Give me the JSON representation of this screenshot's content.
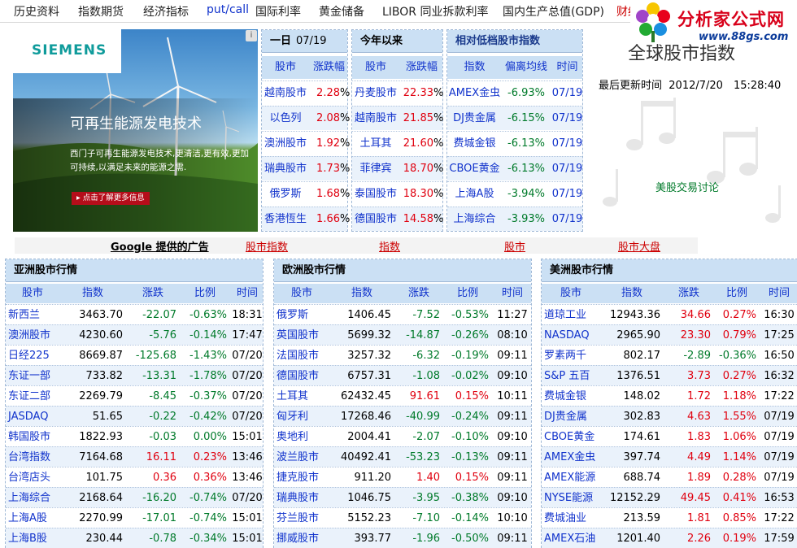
{
  "nav": [
    {
      "label": "历史资料",
      "style": "normal"
    },
    {
      "label": "指数期货",
      "style": "normal"
    },
    {
      "label": "经济指标",
      "style": "normal"
    },
    {
      "label": "put/call",
      "style": "blue"
    },
    {
      "label": "国际利率",
      "style": "normal"
    },
    {
      "label": "黄金储备",
      "style": "normal"
    },
    {
      "label": "LIBOR 同业拆款利率",
      "style": "normal"
    },
    {
      "label": "国内生产总值(GDP)",
      "style": "normal"
    },
    {
      "label": "财经",
      "style": "red"
    }
  ],
  "logo": {
    "brand": "分析家公式网",
    "url": "www.88gs.com"
  },
  "ad": {
    "brand": "SIEMENS",
    "info": "i",
    "headline": "可再生能源发电技术",
    "body": "西门子可再生能源发电技术,更清洁,更有效,更加可持续,以满足未来的能源之需.",
    "cta": "▸ 点击了解更多信息"
  },
  "day_panel": {
    "title": "一日",
    "date": "07/19",
    "headers": [
      "股市",
      "涨跌幅"
    ],
    "rows": [
      {
        "name": "越南股市",
        "val": "2.28",
        "pct": "%"
      },
      {
        "name": "以色列",
        "val": "2.08",
        "pct": "%"
      },
      {
        "name": "澳洲股市",
        "val": "1.92",
        "pct": "%"
      },
      {
        "name": "瑞典股市",
        "val": "1.73",
        "pct": "%"
      },
      {
        "name": "俄罗斯",
        "val": "1.68",
        "pct": "%"
      },
      {
        "name": "香港恆生",
        "val": "1.66",
        "pct": "%"
      }
    ]
  },
  "ytd_panel": {
    "title": "今年以来",
    "headers": [
      "股市",
      "涨跌幅"
    ],
    "rows": [
      {
        "name": "丹麦股市",
        "val": "22.33",
        "pct": "%"
      },
      {
        "name": "越南股市",
        "val": "21.85",
        "pct": "%"
      },
      {
        "name": "土耳其",
        "val": "21.60",
        "pct": "%"
      },
      {
        "name": "菲律宾",
        "val": "18.70",
        "pct": "%"
      },
      {
        "name": "泰国股市",
        "val": "18.30",
        "pct": "%"
      },
      {
        "name": "德国股市",
        "val": "14.58",
        "pct": "%"
      }
    ]
  },
  "low_panel": {
    "title": "相对低档股市指数",
    "headers": [
      "指数",
      "偏离均线",
      "时间"
    ],
    "rows": [
      {
        "name": "AMEX金虫",
        "val": "-6.93%",
        "time": "07/19"
      },
      {
        "name": "DJ贵金属",
        "val": "-6.15%",
        "time": "07/19"
      },
      {
        "name": "费城金银",
        "val": "-6.13%",
        "time": "07/19"
      },
      {
        "name": "CBOE黄金",
        "val": "-6.13%",
        "time": "07/19"
      },
      {
        "name": "上海A股",
        "val": "-3.94%",
        "time": "07/19"
      },
      {
        "name": "上海综合",
        "val": "-3.93%",
        "time": "07/19"
      }
    ]
  },
  "global": {
    "title": "全球股市指数",
    "updated_label": "最后更新时间",
    "updated_value": "2012/7/20　15:28:40",
    "discuss": "美股交易讨论"
  },
  "links": [
    "Google 提供的广告",
    "股市指数",
    "指数",
    "股市",
    "股市大盘"
  ],
  "headers": [
    "股市",
    "指数",
    "涨跌",
    "比例",
    "时间"
  ],
  "asia": {
    "title": "亚洲股市行情",
    "rows": [
      {
        "name": "新西兰",
        "idx": "3463.70",
        "chg": "-22.07",
        "pct": "-0.63%",
        "time": "18:31",
        "c": "green"
      },
      {
        "name": "澳洲股市",
        "idx": "4230.60",
        "chg": "-5.76",
        "pct": "-0.14%",
        "time": "17:47",
        "c": "green"
      },
      {
        "name": "日经225",
        "idx": "8669.87",
        "chg": "-125.68",
        "pct": "-1.43%",
        "time": "07/20",
        "c": "green"
      },
      {
        "name": "东证一部",
        "idx": "733.82",
        "chg": "-13.31",
        "pct": "-1.78%",
        "time": "07/20",
        "c": "green"
      },
      {
        "name": "东证二部",
        "idx": "2269.79",
        "chg": "-8.45",
        "pct": "-0.37%",
        "time": "07/20",
        "c": "green"
      },
      {
        "name": "JASDAQ",
        "idx": "51.65",
        "chg": "-0.22",
        "pct": "-0.42%",
        "time": "07/20",
        "c": "green"
      },
      {
        "name": "韩国股市",
        "idx": "1822.93",
        "chg": "-0.03",
        "pct": "0.00%",
        "time": "15:01",
        "c": "green"
      },
      {
        "name": "台湾指数",
        "idx": "7164.68",
        "chg": "16.11",
        "pct": "0.23%",
        "time": "13:46",
        "c": "red"
      },
      {
        "name": "台湾店头",
        "idx": "101.75",
        "chg": "0.36",
        "pct": "0.36%",
        "time": "13:46",
        "c": "red"
      },
      {
        "name": "上海综合",
        "idx": "2168.64",
        "chg": "-16.20",
        "pct": "-0.74%",
        "time": "07/20",
        "c": "green"
      },
      {
        "name": "上海A股",
        "idx": "2270.99",
        "chg": "-17.01",
        "pct": "-0.74%",
        "time": "15:01",
        "c": "green"
      },
      {
        "name": "上海B股",
        "idx": "230.44",
        "chg": "-0.78",
        "pct": "-0.34%",
        "time": "15:01",
        "c": "green"
      }
    ]
  },
  "europe": {
    "title": "欧洲股市行情",
    "rows": [
      {
        "name": "俄罗斯",
        "idx": "1406.45",
        "chg": "-7.52",
        "pct": "-0.53%",
        "time": "11:27",
        "c": "green"
      },
      {
        "name": "英国股市",
        "idx": "5699.32",
        "chg": "-14.87",
        "pct": "-0.26%",
        "time": "08:10",
        "c": "green"
      },
      {
        "name": "法国股市",
        "idx": "3257.32",
        "chg": "-6.32",
        "pct": "-0.19%",
        "time": "09:11",
        "c": "green"
      },
      {
        "name": "德国股市",
        "idx": "6757.31",
        "chg": "-1.08",
        "pct": "-0.02%",
        "time": "09:10",
        "c": "green"
      },
      {
        "name": "土耳其",
        "idx": "62432.45",
        "chg": "91.61",
        "pct": "0.15%",
        "time": "10:11",
        "c": "red"
      },
      {
        "name": "匈牙利",
        "idx": "17268.46",
        "chg": "-40.99",
        "pct": "-0.24%",
        "time": "09:11",
        "c": "green"
      },
      {
        "name": "奥地利",
        "idx": "2004.41",
        "chg": "-2.07",
        "pct": "-0.10%",
        "time": "09:10",
        "c": "green"
      },
      {
        "name": "波兰股市",
        "idx": "40492.41",
        "chg": "-53.23",
        "pct": "-0.13%",
        "time": "09:11",
        "c": "green"
      },
      {
        "name": "捷克股市",
        "idx": "911.20",
        "chg": "1.40",
        "pct": "0.15%",
        "time": "09:11",
        "c": "red"
      },
      {
        "name": "瑞典股市",
        "idx": "1046.75",
        "chg": "-3.95",
        "pct": "-0.38%",
        "time": "09:10",
        "c": "green"
      },
      {
        "name": "芬兰股市",
        "idx": "5152.23",
        "chg": "-7.10",
        "pct": "-0.14%",
        "time": "10:10",
        "c": "green"
      },
      {
        "name": "挪威股市",
        "idx": "393.77",
        "chg": "-1.96",
        "pct": "-0.50%",
        "time": "09:11",
        "c": "green"
      }
    ]
  },
  "us": {
    "title": "美洲股市行情",
    "rows": [
      {
        "name": "道琼工业",
        "idx": "12943.36",
        "chg": "34.66",
        "pct": "0.27%",
        "time": "16:30",
        "c": "red"
      },
      {
        "name": "NASDAQ",
        "idx": "2965.90",
        "chg": "23.30",
        "pct": "0.79%",
        "time": "17:25",
        "c": "red"
      },
      {
        "name": "罗素两千",
        "idx": "802.17",
        "chg": "-2.89",
        "pct": "-0.36%",
        "time": "16:50",
        "c": "green"
      },
      {
        "name": "S&P 五百",
        "idx": "1376.51",
        "chg": "3.73",
        "pct": "0.27%",
        "time": "16:32",
        "c": "red"
      },
      {
        "name": "费城金银",
        "idx": "148.02",
        "chg": "1.72",
        "pct": "1.18%",
        "time": "17:22",
        "c": "red"
      },
      {
        "name": "DJ贵金属",
        "idx": "302.83",
        "chg": "4.63",
        "pct": "1.55%",
        "time": "07/19",
        "c": "red"
      },
      {
        "name": "CBOE黄金",
        "idx": "174.61",
        "chg": "1.83",
        "pct": "1.06%",
        "time": "07/19",
        "c": "red"
      },
      {
        "name": "AMEX金虫",
        "idx": "397.74",
        "chg": "4.49",
        "pct": "1.14%",
        "time": "07/19",
        "c": "red"
      },
      {
        "name": "AMEX能源",
        "idx": "688.74",
        "chg": "1.89",
        "pct": "0.28%",
        "time": "07/19",
        "c": "red"
      },
      {
        "name": "NYSE能源",
        "idx": "12152.29",
        "chg": "49.45",
        "pct": "0.41%",
        "time": "16:53",
        "c": "red"
      },
      {
        "name": "费城油业",
        "idx": "213.59",
        "chg": "1.81",
        "pct": "0.85%",
        "time": "17:22",
        "c": "red"
      },
      {
        "name": "AMEX石油",
        "idx": "1201.40",
        "chg": "2.26",
        "pct": "0.19%",
        "time": "17:59",
        "c": "red"
      }
    ]
  }
}
